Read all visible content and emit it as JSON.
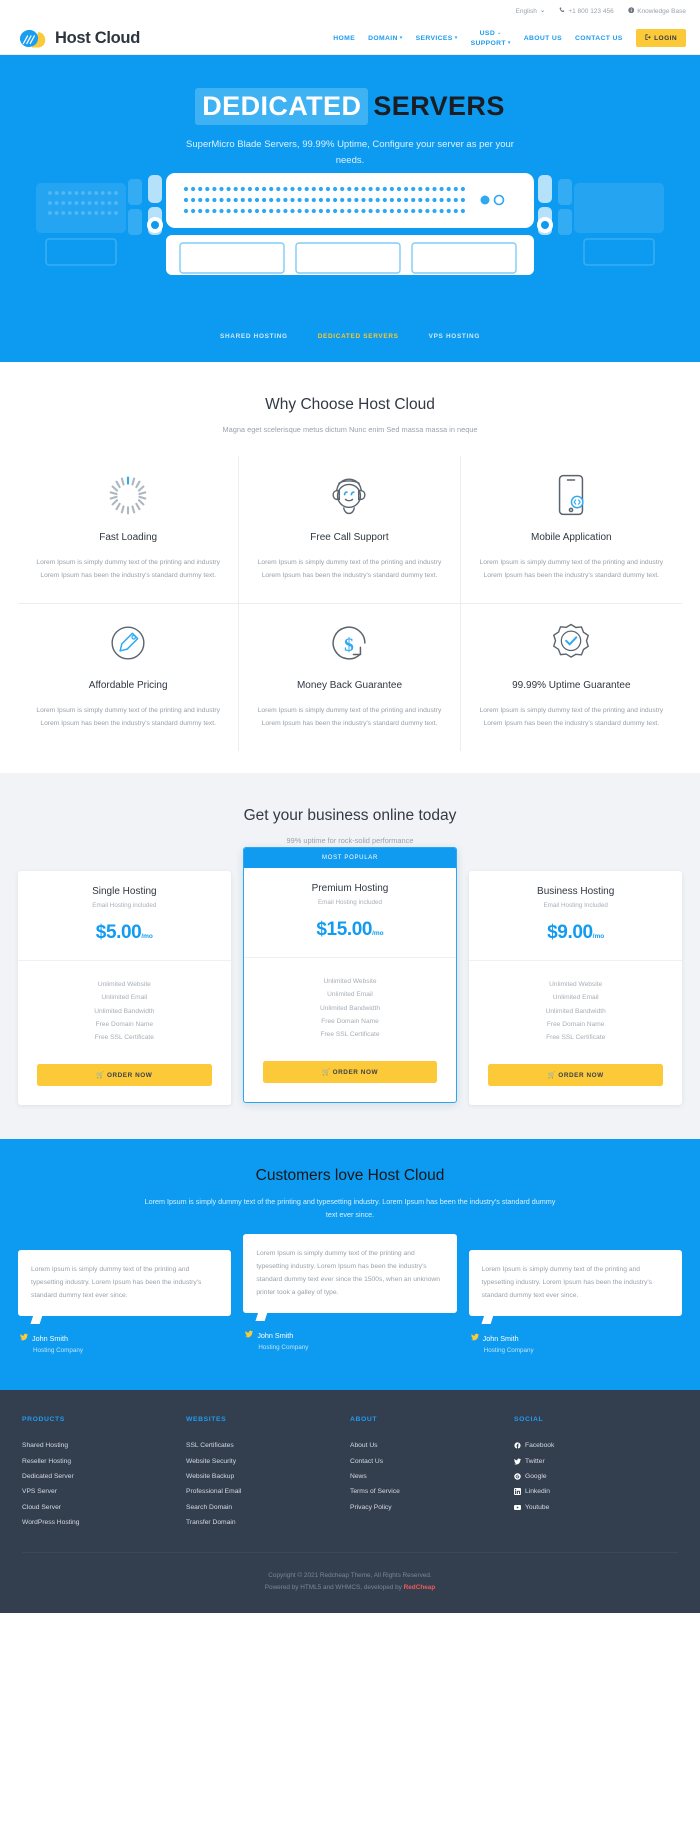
{
  "topbar": {
    "language": "English",
    "language_caret": "⌄",
    "phone": "+1 800 123 456",
    "phone_icon": "phone-icon",
    "knowledge_base": "Knowledge Base",
    "kb_icon": "info-circle-icon"
  },
  "header": {
    "brand": "Host Cloud",
    "nav": [
      {
        "label": "HOME",
        "caret": ""
      },
      {
        "label": "DOMAIN",
        "caret": "▾"
      },
      {
        "label": "SERVICES",
        "caret": "▾"
      },
      {
        "label": "SUPPORT",
        "caret": "▾"
      },
      {
        "label": "ABOUT US",
        "caret": ""
      },
      {
        "label": "CONTACT US",
        "caret": ""
      }
    ],
    "currency": "USD",
    "currency_caret": "⌄",
    "login": "LOGIN",
    "login_icon": "login-arrow-icon"
  },
  "hero": {
    "title_highlight": "DEDICATED",
    "title_rest": "SERVERS",
    "subtitle": "SuperMicro Blade Servers, 99.99% Uptime, Configure your server as per your needs.",
    "tabs": [
      {
        "label": "SHARED HOSTING",
        "active": false
      },
      {
        "label": "DEDICATED SERVERS",
        "active": true
      },
      {
        "label": "VPS HOSTING",
        "active": false
      }
    ],
    "bg_color": "#0c9bf0",
    "highlight_color": "#3fb2f4",
    "active_tab_color": "#fdc830"
  },
  "why": {
    "title": "Why Choose Host Cloud",
    "subtitle": "Magna eget scelerisque metus dictum Nunc enim Sed massa massa in neque",
    "features": [
      {
        "icon": "spinner-loading-icon",
        "title": "Fast Loading",
        "desc": "Lorem Ipsum is simply dummy text of the printing and industry Lorem Ipsum has been the industry's standard dummy text."
      },
      {
        "icon": "support-agent-icon",
        "title": "Free Call Support",
        "desc": "Lorem Ipsum is simply dummy text of the printing and industry Lorem Ipsum has been the industry's standard dummy text."
      },
      {
        "icon": "mobile-phone-icon",
        "title": "Mobile Application",
        "desc": "Lorem Ipsum is simply dummy text of the printing and industry Lorem Ipsum has been the industry's standard dummy text."
      },
      {
        "icon": "price-tag-icon",
        "title": "Affordable Pricing",
        "desc": "Lorem Ipsum is simply dummy text of the printing and industry Lorem Ipsum has been the industry's standard dummy text."
      },
      {
        "icon": "dollar-refund-icon",
        "title": "Money Back Guarantee",
        "desc": "Lorem Ipsum is simply dummy text of the printing and industry Lorem Ipsum has been the industry's standard dummy text."
      },
      {
        "icon": "badge-check-icon",
        "title": "99.99% Uptime Guarantee",
        "desc": "Lorem Ipsum is simply dummy text of the printing and industry Lorem Ipsum has been the industry's standard dummy text."
      }
    ]
  },
  "pricing": {
    "title": "Get your business online today",
    "subtitle": "99% uptime for rock-solid performance",
    "popular_flag": "MOST POPULAR",
    "order_label": "ORDER NOW",
    "order_icon": "shopping-cart-icon",
    "plans": [
      {
        "name": "Single Hosting",
        "note": "Email Hosting included",
        "price": "$5.00",
        "period": "/mo",
        "popular": false,
        "features": [
          "Unlimited Website",
          "Unlimited Email",
          "Unlimited Bandwidth",
          "Free Domain Name",
          "Free SSL Certificate"
        ]
      },
      {
        "name": "Premium Hosting",
        "note": "Email Hosting included",
        "price": "$15.00",
        "period": "/mo",
        "popular": true,
        "features": [
          "Unlimited Website",
          "Unlimited Email",
          "Unlimited Bandwidth",
          "Free Domain Name",
          "Free SSL Certificate"
        ]
      },
      {
        "name": "Business Hosting",
        "note": "Email Hosting Included",
        "price": "$9.00",
        "period": "/mo",
        "popular": false,
        "features": [
          "Unlimited Website",
          "Unlimited Email",
          "Unlimited Bandwidth",
          "Free Domain Name",
          "Free SSL Certificate"
        ]
      }
    ]
  },
  "testimonials": {
    "title": "Customers love Host Cloud",
    "subtitle": "Lorem Ipsum is simply dummy text of the printing and typesetting industry. Lorem Ipsum has been the industry's standard dummy text ever since.",
    "items": [
      {
        "quote": "Lorem Ipsum is simply dummy text of the printing and typesetting industry. Lorem Ipsum has been the industry's standard dummy text ever since.",
        "author": "John Smith",
        "role": "Hosting Company",
        "icon": "twitter-icon"
      },
      {
        "quote": "Lorem Ipsum is simply dummy text of the printing and typesetting industry. Lorem Ipsum has been the industry's standard dummy text ever since the 1500s, when an unknown printer took a galley of type.",
        "author": "John Smith",
        "role": "Hosting Company",
        "icon": "twitter-icon"
      },
      {
        "quote": "Lorem Ipsum is simply dummy text of the printing and typesetting industry. Lorem Ipsum has been the industry's standard dummy text ever since.",
        "author": "John Smith",
        "role": "Hosting Company",
        "icon": "twitter-icon"
      }
    ]
  },
  "footer": {
    "columns": [
      {
        "head": "PRODUCTS",
        "links": [
          {
            "label": "Shared Hosting",
            "icon": ""
          },
          {
            "label": "Reseller Hosting",
            "icon": ""
          },
          {
            "label": "Dedicated Server",
            "icon": ""
          },
          {
            "label": "VPS Server",
            "icon": ""
          },
          {
            "label": "Cloud Server",
            "icon": ""
          },
          {
            "label": "WordPress Hosting",
            "icon": ""
          }
        ]
      },
      {
        "head": "WEBSITES",
        "links": [
          {
            "label": "SSL Certificates",
            "icon": ""
          },
          {
            "label": "Website Security",
            "icon": ""
          },
          {
            "label": "Website Backup",
            "icon": ""
          },
          {
            "label": "Professional Email",
            "icon": ""
          },
          {
            "label": "Search Domain",
            "icon": ""
          },
          {
            "label": "Transfer Domain",
            "icon": ""
          }
        ]
      },
      {
        "head": "ABOUT",
        "links": [
          {
            "label": "About Us",
            "icon": ""
          },
          {
            "label": "Contact Us",
            "icon": ""
          },
          {
            "label": "News",
            "icon": ""
          },
          {
            "label": "Terms of Service",
            "icon": ""
          },
          {
            "label": "Privacy Policy",
            "icon": ""
          }
        ]
      },
      {
        "head": "SOCIAL",
        "links": [
          {
            "label": "Facebook",
            "icon": "facebook-icon"
          },
          {
            "label": "Twitter",
            "icon": "twitter-icon"
          },
          {
            "label": "Google",
            "icon": "google-icon"
          },
          {
            "label": "Linkedin",
            "icon": "linkedin-icon"
          },
          {
            "label": "Youtube",
            "icon": "youtube-icon"
          }
        ]
      }
    ],
    "copyright": "Copyright © 2021 Redcheap Theme, All Rights Reserved.",
    "powered_prefix": "Powered by HTML5 and WHMCS, developed by ",
    "powered_brand": "RedCheap"
  }
}
